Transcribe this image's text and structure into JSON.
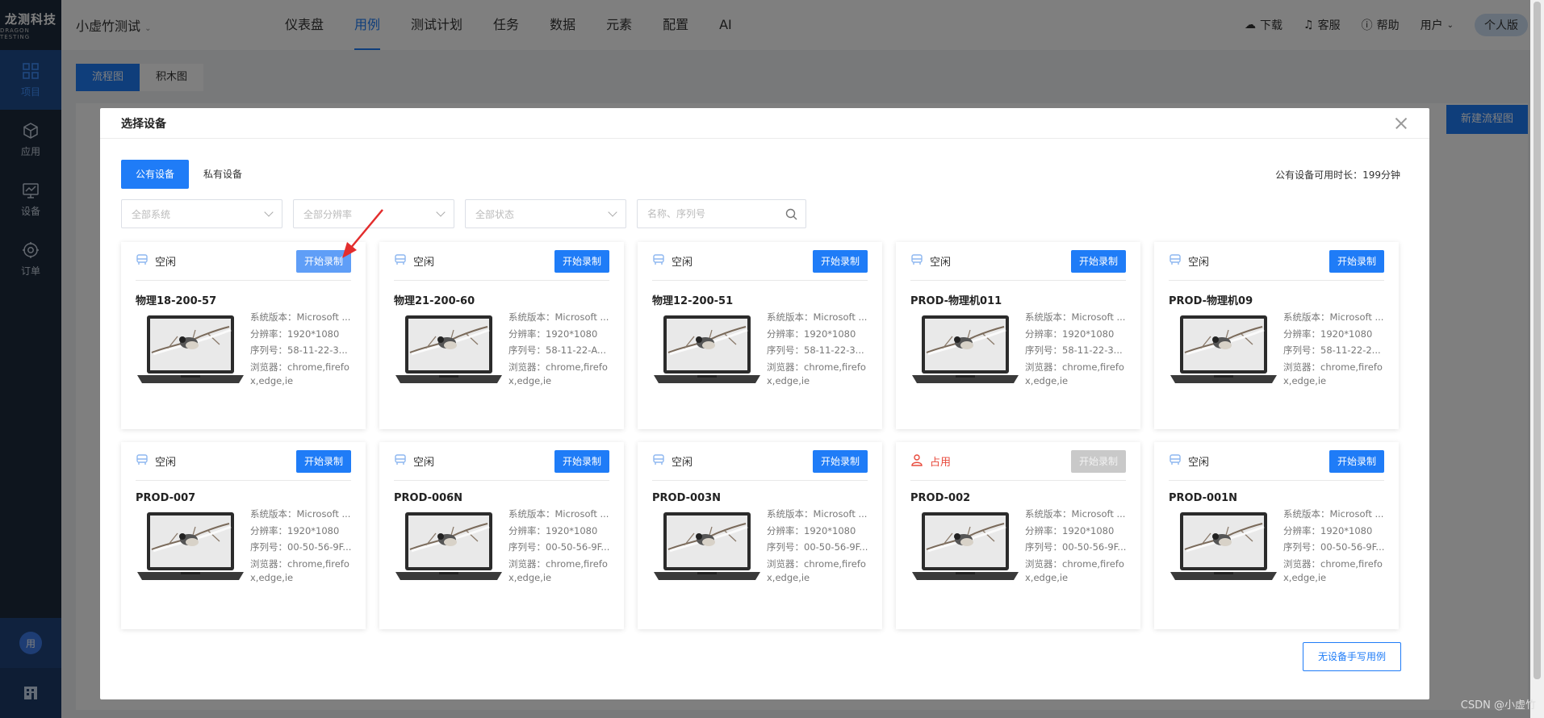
{
  "app": {
    "logo_main": "龙测科技",
    "logo_sub": "DRAGON TESTING",
    "project_name": "小虚竹测试",
    "nav": [
      "仪表盘",
      "用例",
      "测试计划",
      "任务",
      "数据",
      "元素",
      "配置",
      "AI"
    ],
    "nav_active": "用例",
    "sidebar": [
      {
        "label": "项目",
        "icon": "grid-icon"
      },
      {
        "label": "应用",
        "icon": "cube-icon"
      },
      {
        "label": "设备",
        "icon": "monitor-icon"
      },
      {
        "label": "订单",
        "icon": "gear-icon"
      }
    ],
    "sidebar_user": "用",
    "top_links": [
      {
        "label": "下载",
        "icon": "cloud-download-icon"
      },
      {
        "label": "客服",
        "icon": "headset-icon"
      },
      {
        "label": "帮助",
        "icon": "help-icon"
      },
      {
        "label": "用户",
        "icon": "chevron-down-icon"
      }
    ],
    "edition": "个人版",
    "subtabs": [
      "流程图",
      "积木图"
    ],
    "new_flow_button": "新建流程图"
  },
  "modal": {
    "title": "选择设备",
    "tabs": [
      "公有设备",
      "私有设备"
    ],
    "quota": "公有设备可用时长：199分钟",
    "filters": {
      "system": "全部系统",
      "resolution": "全部分辨率",
      "status": "全部状态",
      "search_placeholder": "名称、序列号"
    },
    "labels": {
      "os": "系统版本：",
      "resolution": "分辨率：",
      "serial": "序列号：",
      "browser": "浏览器："
    },
    "devices": [
      {
        "name": "物理18-200-57",
        "status": "空闲",
        "busy": false,
        "button": "开始录制",
        "btn_state": "hover",
        "os": "Microsoft ...",
        "resolution": "1920*1080",
        "serial": "58-11-22-3...",
        "browser": "chrome,firefox,edge,ie"
      },
      {
        "name": "物理21-200-60",
        "status": "空闲",
        "busy": false,
        "button": "开始录制",
        "btn_state": "normal",
        "os": "Microsoft ...",
        "resolution": "1920*1080",
        "serial": "58-11-22-A...",
        "browser": "chrome,firefox,edge,ie"
      },
      {
        "name": "物理12-200-51",
        "status": "空闲",
        "busy": false,
        "button": "开始录制",
        "btn_state": "normal",
        "os": "Microsoft ...",
        "resolution": "1920*1080",
        "serial": "58-11-22-3...",
        "browser": "chrome,firefox,edge,ie"
      },
      {
        "name": "PROD-物理机011",
        "status": "空闲",
        "busy": false,
        "button": "开始录制",
        "btn_state": "normal",
        "os": "Microsoft ...",
        "resolution": "1920*1080",
        "serial": "58-11-22-3...",
        "browser": "chrome,firefox,edge,ie"
      },
      {
        "name": "PROD-物理机09",
        "status": "空闲",
        "busy": false,
        "button": "开始录制",
        "btn_state": "normal",
        "os": "Microsoft ...",
        "resolution": "1920*1080",
        "serial": "58-11-22-2...",
        "browser": "chrome,firefox,edge,ie"
      },
      {
        "name": "PROD-007",
        "status": "空闲",
        "busy": false,
        "button": "开始录制",
        "btn_state": "normal",
        "os": "Microsoft ...",
        "resolution": "1920*1080",
        "serial": "00-50-56-9F...",
        "browser": "chrome,firefox,edge,ie"
      },
      {
        "name": "PROD-006N",
        "status": "空闲",
        "busy": false,
        "button": "开始录制",
        "btn_state": "normal",
        "os": "Microsoft ...",
        "resolution": "1920*1080",
        "serial": "00-50-56-9F...",
        "browser": "chrome,firefox,edge,ie"
      },
      {
        "name": "PROD-003N",
        "status": "空闲",
        "busy": false,
        "button": "开始录制",
        "btn_state": "normal",
        "os": "Microsoft ...",
        "resolution": "1920*1080",
        "serial": "00-50-56-9F...",
        "browser": "chrome,firefox,edge,ie"
      },
      {
        "name": "PROD-002",
        "status": "占用",
        "busy": true,
        "button": "开始录制",
        "btn_state": "disabled",
        "os": "Microsoft ...",
        "resolution": "1920*1080",
        "serial": "00-50-56-9F...",
        "browser": "chrome,firefox,edge,ie"
      },
      {
        "name": "PROD-001N",
        "status": "空闲",
        "busy": false,
        "button": "开始录制",
        "btn_state": "normal",
        "os": "Microsoft ...",
        "resolution": "1920*1080",
        "serial": "00-50-56-9F...",
        "browser": "chrome,firefox,edge,ie"
      }
    ],
    "manual_button": "无设备手写用例"
  },
  "watermark": "CSDN @小虚竹",
  "colors": {
    "primary": "#1f7cf7",
    "busy": "#e84a3c",
    "sidebar": "#1c2a3d"
  }
}
